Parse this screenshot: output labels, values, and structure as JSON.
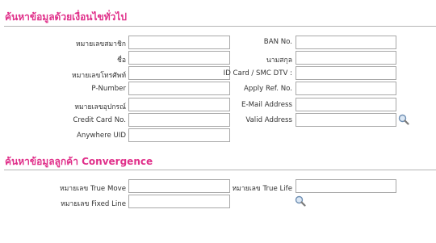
{
  "general_search": {
    "title": "ค้นหาข้อมูลด้วยเงื่อนไขทั่วไป",
    "fields": {
      "member_no": {
        "label": "หมายเลขสมาชิก",
        "value": ""
      },
      "ban_no": {
        "label": "BAN No.",
        "value": ""
      },
      "name": {
        "label": "ชื่อ",
        "value": ""
      },
      "surname": {
        "label": "นามสกุล",
        "value": ""
      },
      "phone_no": {
        "label": "หมายเลขโทรศัพท์",
        "value": ""
      },
      "id_card": {
        "label": "ID Card / SMC DTV :",
        "value": ""
      },
      "p_number": {
        "label": "P-Number",
        "value": ""
      },
      "apply_ref": {
        "label": "Apply Ref. No.",
        "value": ""
      },
      "device_no": {
        "label": "หมายเลขอุปกรณ์",
        "value": ""
      },
      "email": {
        "label": "E-Mail Address",
        "value": ""
      },
      "credit_card": {
        "label": "Credit Card No.",
        "value": ""
      },
      "valid_address": {
        "label": "Valid Address",
        "value": ""
      },
      "anywhere_uid": {
        "label": "Anywhere UID",
        "value": ""
      }
    },
    "search_icon": "search-icon"
  },
  "convergence_search": {
    "title": "ค้นหาข้อมูลลูกค้า Convergence",
    "fields": {
      "true_move": {
        "label": "หมายเลข True Move",
        "value": ""
      },
      "true_life": {
        "label": "หมายเลข True Life",
        "value": ""
      },
      "fixed_line": {
        "label": "หมายเลข Fixed Line",
        "value": ""
      }
    },
    "search_icon": "search-icon"
  },
  "colors": {
    "accent": "#e0308a",
    "rule": "#b5b5b5",
    "border": "#a8a8a8"
  }
}
